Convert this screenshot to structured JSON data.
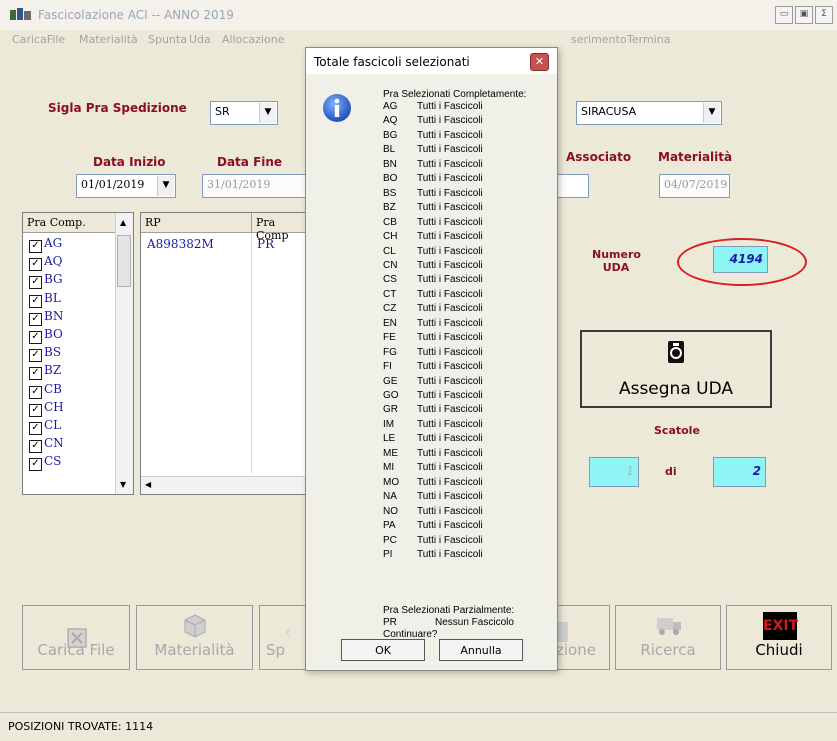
{
  "window": {
    "title": "Fascicolazione ACI -- ANNO 2019",
    "controls": [
      "▭",
      "▣",
      "Σ"
    ]
  },
  "menu": {
    "left": [
      "CaricaFile",
      "Materialità",
      "Spunta",
      "Uda",
      "Allocazione"
    ],
    "right": [
      "serimento",
      "Termina"
    ]
  },
  "form": {
    "sigla_label": "Sigla Pra Spedizione",
    "sigla_value": "SR",
    "city_value": "SIRACUSA",
    "data_inizio_label": "Data Inizio",
    "data_inizio_value": "01/01/2019",
    "data_fine_label": "Data Fine",
    "data_fine_value": "31/01/2019",
    "associato_label": "Associato",
    "materialita_label": "Materialità",
    "materialita_value": "04/07/2019",
    "numero_uda_label_1": "Numero",
    "numero_uda_label_2": "UDA",
    "numero_uda_value": "4194",
    "assegna_label": "Assegna UDA",
    "scatole_label": "Scatole",
    "scatole_current": "1",
    "scatole_di": "di",
    "scatole_total": "2"
  },
  "pra_list": {
    "header": "Pra Comp.",
    "items": [
      "AG",
      "AQ",
      "BG",
      "BL",
      "BN",
      "BO",
      "BS",
      "BZ",
      "CB",
      "CH",
      "CL",
      "CN",
      "CS"
    ]
  },
  "rp_table": {
    "headers": [
      "RP",
      "Pra Comp"
    ],
    "rows": [
      [
        "A898382M",
        "PR"
      ]
    ]
  },
  "toolbar": [
    "Carica File",
    "Materialità",
    "Sp",
    "zione",
    "Ricerca",
    "Chiudi"
  ],
  "exit_label": "EXIT",
  "status": "POSIZIONI TROVATE: 1114",
  "dialog": {
    "title": "Totale fascicoli selezionati",
    "complete_header": "Pra Selezionati Completamente:",
    "complete": [
      [
        "AG",
        "Tutti i Fascicoli"
      ],
      [
        "AQ",
        "Tutti i Fascicoli"
      ],
      [
        "BG",
        "Tutti i Fascicoli"
      ],
      [
        "BL",
        "Tutti i Fascicoli"
      ],
      [
        "BN",
        "Tutti i Fascicoli"
      ],
      [
        "BO",
        "Tutti i Fascicoli"
      ],
      [
        "BS",
        "Tutti i Fascicoli"
      ],
      [
        "BZ",
        "Tutti i Fascicoli"
      ],
      [
        "CB",
        "Tutti i Fascicoli"
      ],
      [
        "CH",
        "Tutti i Fascicoli"
      ],
      [
        "CL",
        "Tutti i Fascicoli"
      ],
      [
        "CN",
        "Tutti i Fascicoli"
      ],
      [
        "CS",
        "Tutti i Fascicoli"
      ],
      [
        "CT",
        "Tutti i Fascicoli"
      ],
      [
        "CZ",
        "Tutti i Fascicoli"
      ],
      [
        "EN",
        "Tutti i Fascicoli"
      ],
      [
        "FE",
        "Tutti i Fascicoli"
      ],
      [
        "FG",
        "Tutti i Fascicoli"
      ],
      [
        "FI",
        "Tutti i Fascicoli"
      ],
      [
        "GE",
        "Tutti i Fascicoli"
      ],
      [
        "GO",
        "Tutti i Fascicoli"
      ],
      [
        "GR",
        "Tutti i Fascicoli"
      ],
      [
        "IM",
        "Tutti i Fascicoli"
      ],
      [
        "LE",
        "Tutti i Fascicoli"
      ],
      [
        "ME",
        "Tutti i Fascicoli"
      ],
      [
        "MI",
        "Tutti i Fascicoli"
      ],
      [
        "MO",
        "Tutti i Fascicoli"
      ],
      [
        "NA",
        "Tutti i Fascicoli"
      ],
      [
        "NO",
        "Tutti i Fascicoli"
      ],
      [
        "PA",
        "Tutti i Fascicoli"
      ],
      [
        "PC",
        "Tutti i Fascicoli"
      ],
      [
        "PI",
        "Tutti i Fascicoli"
      ]
    ],
    "partial_header": "Pra Selezionati Parzialmente:",
    "partial": [
      [
        "PR",
        "Nessun Fascicolo"
      ]
    ],
    "question": "Continuare?",
    "ok": "OK",
    "cancel": "Annulla"
  }
}
